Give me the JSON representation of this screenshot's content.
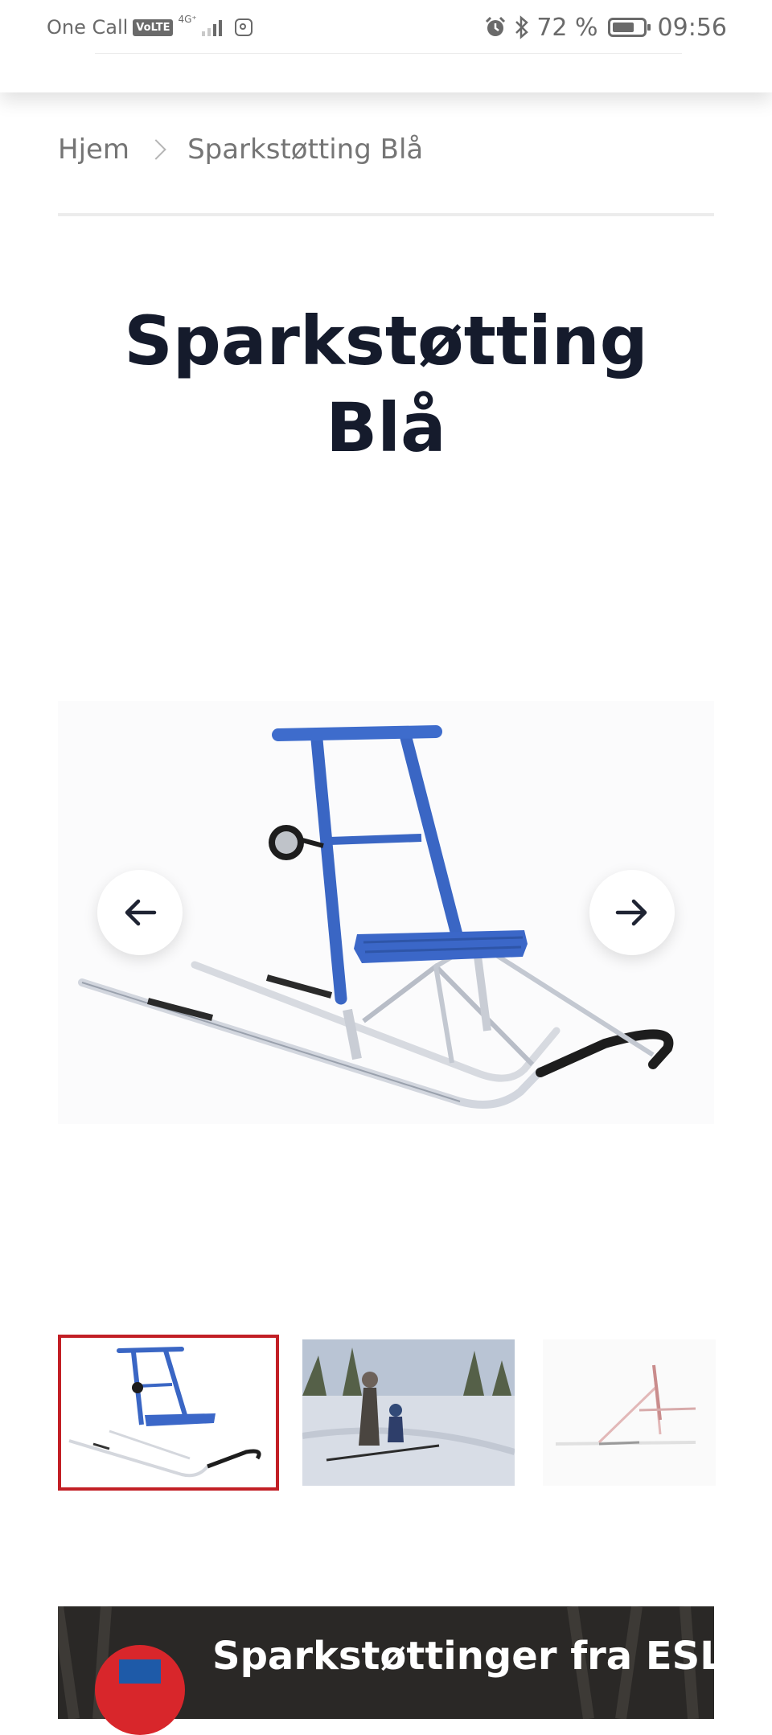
{
  "status_bar": {
    "carrier": "One Call",
    "volte": "VoLTE",
    "network": "4G⁺",
    "battery_percent": "72 %",
    "battery_level": 0.72,
    "time": "09:56",
    "icons": [
      "signal-icon",
      "instagram-icon",
      "alarm-icon",
      "bluetooth-icon",
      "battery-icon"
    ]
  },
  "breadcrumb": {
    "home": "Hjem",
    "current": "Sparkstøtting Blå"
  },
  "product": {
    "title": "Sparkstøtting Blå"
  },
  "gallery": {
    "prev_icon": "arrow-left-icon",
    "next_icon": "arrow-right-icon",
    "selected_index": 0,
    "accent_color": "#c21f25"
  },
  "video": {
    "title": "Sparkstøttinger fra ESLA"
  },
  "colors": {
    "title": "#151b2c",
    "sled_blue": "#3a66c4",
    "thumbnail_border": "#c21f25"
  }
}
